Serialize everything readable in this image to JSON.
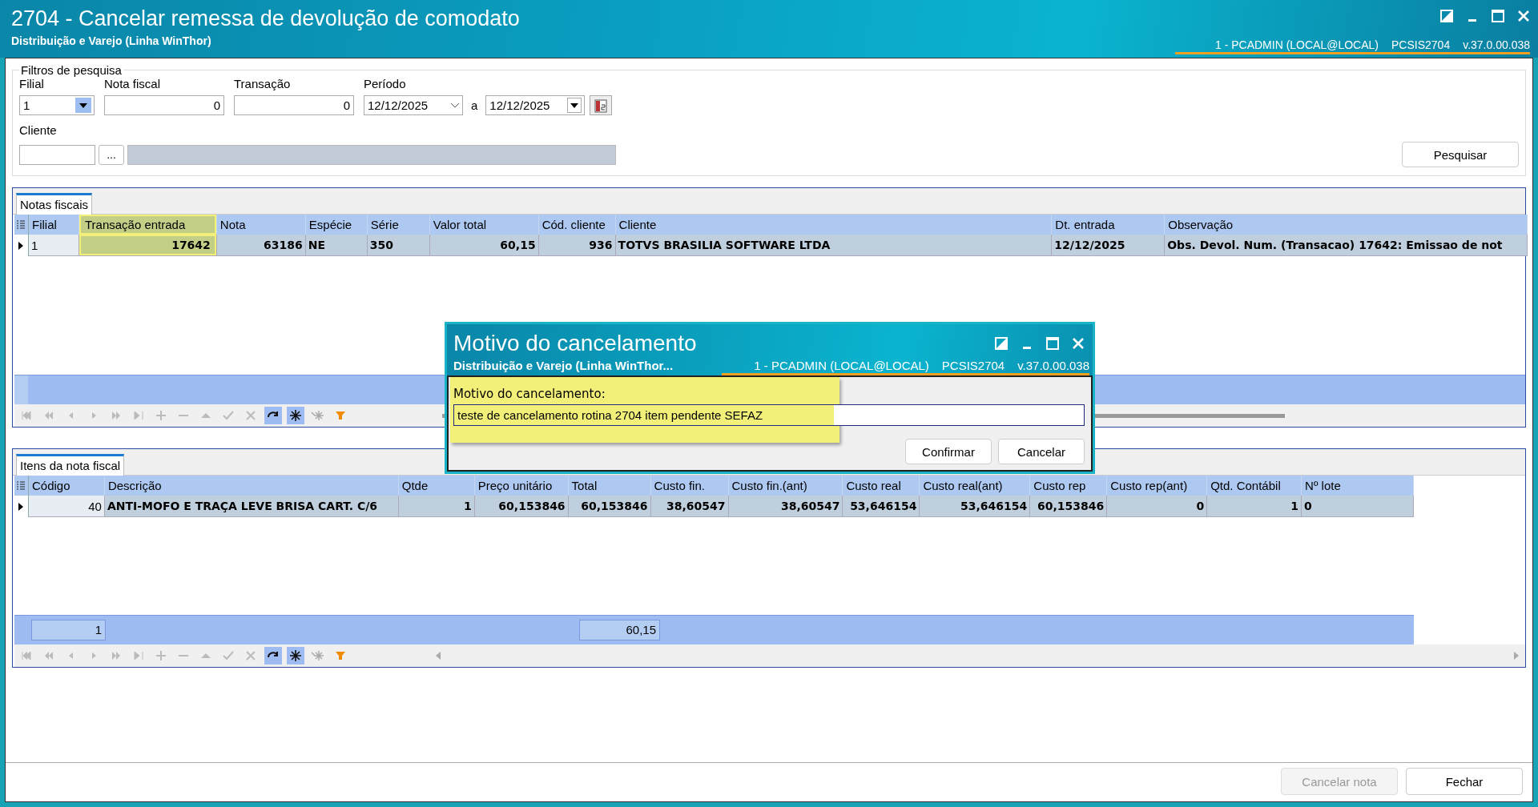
{
  "window": {
    "title": "2704 - Cancelar remessa de devolução de comodato",
    "subtitle": "Distribuição e Varejo (Linha WinThor)",
    "session": "1 - PCADMIN (LOCAL@LOCAL)",
    "program": "PCSIS2704",
    "version": "v.37.0.00.038"
  },
  "filters": {
    "group_title": "Filtros de pesquisa",
    "filial": {
      "label": "Filial",
      "value": "1"
    },
    "nota_fiscal": {
      "label": "Nota fiscal",
      "value": "0"
    },
    "transacao": {
      "label": "Transação",
      "value": "0"
    },
    "periodo": {
      "label": "Período",
      "from": "12/12/2025",
      "separator": "a",
      "to": "12/12/2025"
    },
    "cliente": {
      "label": "Cliente",
      "browse": "..."
    },
    "search_button": {
      "label": "Pesquisar"
    }
  },
  "notes_grid": {
    "tab": "Notas fiscais",
    "columns": [
      {
        "label": "Filial",
        "highlighted": false
      },
      {
        "label": "Transação entrada",
        "highlighted": true
      },
      {
        "label": "Nota",
        "highlighted": false
      },
      {
        "label": "Espécie",
        "highlighted": false
      },
      {
        "label": "Série",
        "highlighted": false
      },
      {
        "label": "Valor total",
        "highlighted": false
      },
      {
        "label": "Cód. cliente",
        "highlighted": false
      },
      {
        "label": "Cliente",
        "highlighted": false
      },
      {
        "label": "Dt. entrada",
        "highlighted": false
      },
      {
        "label": "Observação",
        "highlighted": false
      }
    ],
    "rows": [
      {
        "selected": true,
        "cells": [
          "1",
          "17642",
          "63186",
          "NE",
          "350",
          "60,15",
          "936",
          "TOTVS BRASILIA SOFTWARE LTDA",
          "12/12/2025",
          "Obs. Devol. Num. (Transacao) 17642: Emissao de not"
        ]
      }
    ]
  },
  "items_grid": {
    "tab": "Itens da nota fiscal",
    "columns": [
      "Código",
      "Descrição",
      "Qtde",
      "Preço unitário",
      "Total",
      "Custo fin.",
      "Custo fin.(ant)",
      "Custo real",
      "Custo real(ant)",
      "Custo rep",
      "Custo rep(ant)",
      "Qtd. Contábil",
      "Nº lote"
    ],
    "rows": [
      {
        "selected": true,
        "cells": [
          "40",
          "ANTI-MOFO E TRAÇA LEVE BRISA CART. C/6",
          "1",
          "60,153846",
          "60,153846",
          "38,60547",
          "38,60547",
          "53,646154",
          "53,646154",
          "60,153846",
          "0",
          "1",
          "0"
        ]
      }
    ],
    "footer": {
      "count": "1",
      "total": "60,15"
    }
  },
  "buttons": [
    {
      "label": "Cancelar nota",
      "disabled": true
    },
    {
      "label": "Fechar",
      "disabled": false
    }
  ],
  "dialog": {
    "title": "Motivo do cancelamento",
    "subtitle": "Distribuição e Varejo (Linha WinThor...",
    "session": "1 - PCADMIN (LOCAL@LOCAL)",
    "program": "PCSIS2704",
    "version": "v.37.0.00.038",
    "field": {
      "label": "Motivo do cancelamento:",
      "value": "teste de cancelamento rotina 2704 item pendente SEFAZ",
      "highlighted": true
    },
    "buttons": [
      "Confirmar",
      "Cancelar"
    ]
  }
}
